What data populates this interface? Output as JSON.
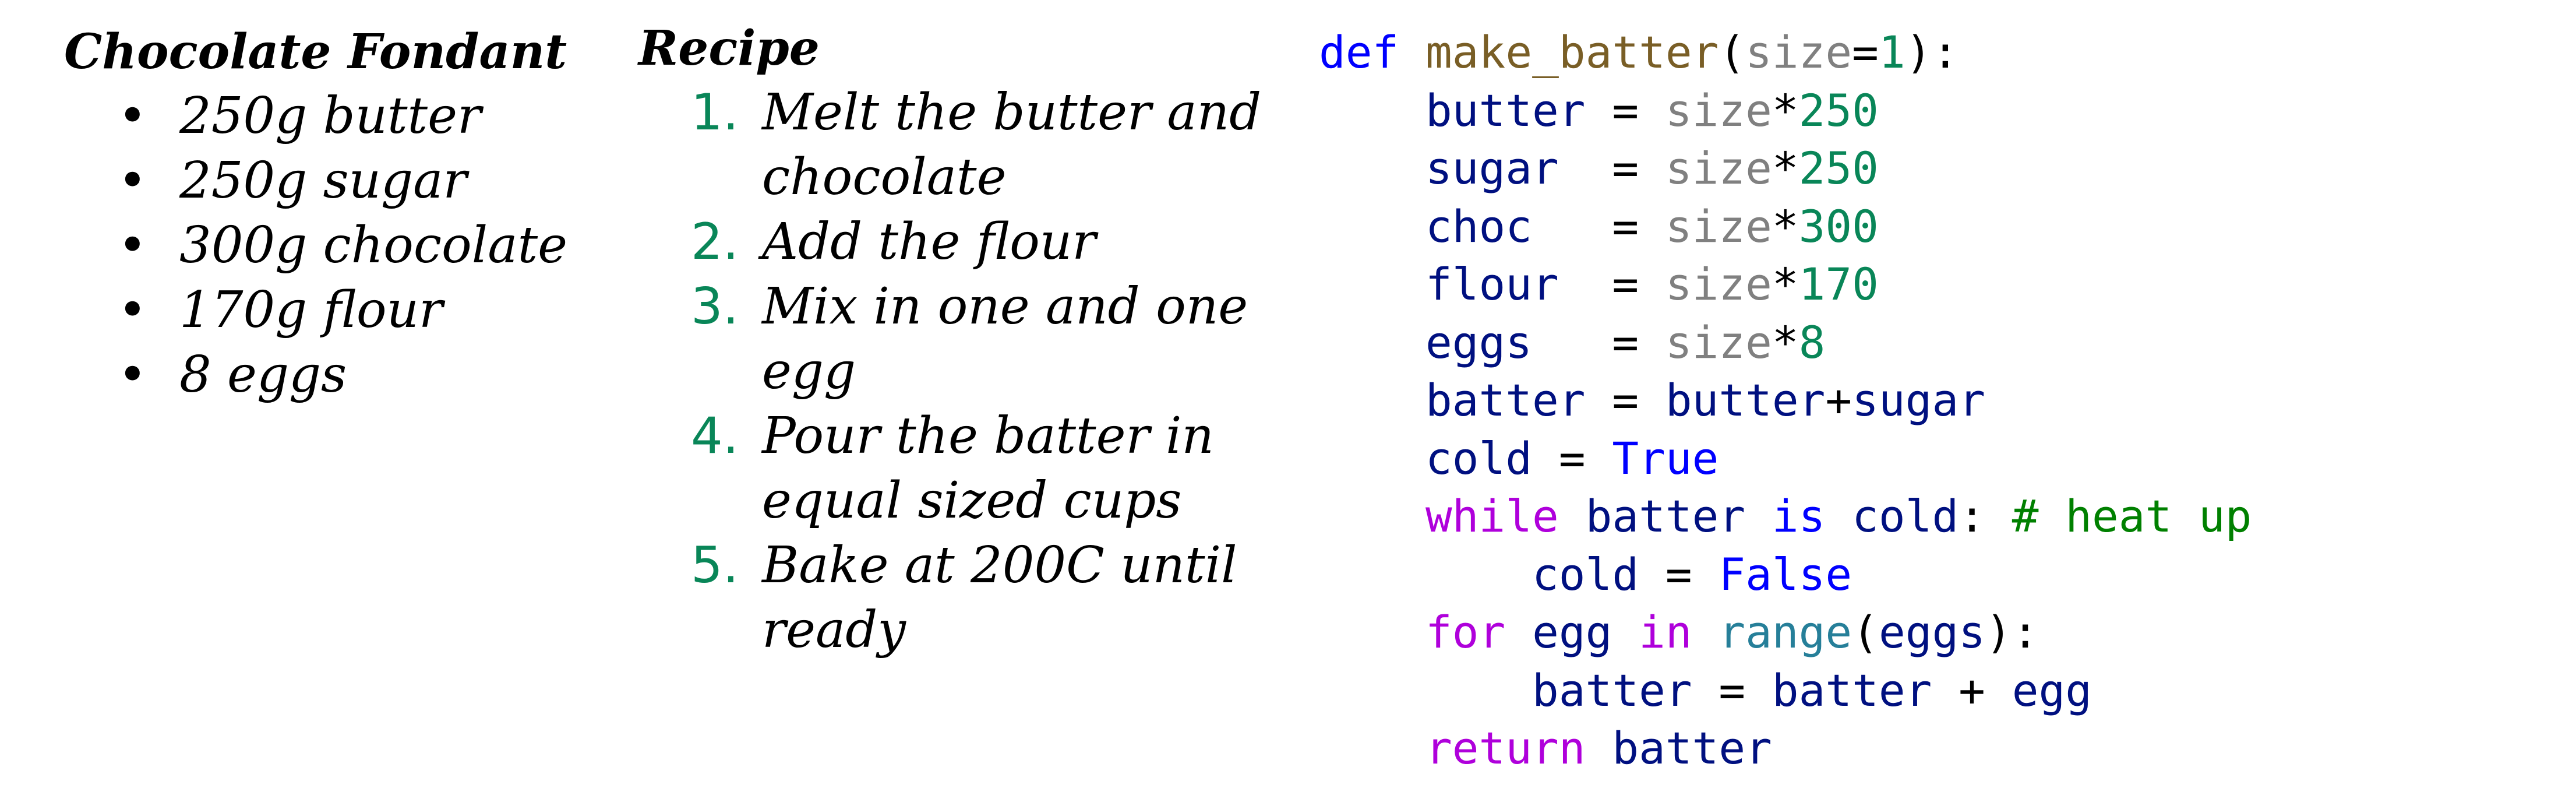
{
  "ingredients": {
    "title": "Chocolate Fondant",
    "items": [
      "250g butter",
      "250g sugar",
      "300g chocolate",
      "170g flour",
      "8 eggs"
    ]
  },
  "recipe": {
    "title": "Recipe",
    "steps": [
      {
        "number": "1.",
        "text": "Melt the butter and chocolate"
      },
      {
        "number": "2.",
        "text": "Add the flour"
      },
      {
        "number": "3.",
        "text": "Mix in one and one egg"
      },
      {
        "number": "4.",
        "text": "Pour the batter in equal sized cups"
      },
      {
        "number": "5.",
        "text": "Bake at 200C until ready"
      }
    ]
  },
  "code": {
    "lines": [
      [
        {
          "t": "def",
          "c": "kw-def"
        },
        {
          "t": " ",
          "c": "op"
        },
        {
          "t": "make_batter",
          "c": "fn"
        },
        {
          "t": "(",
          "c": "op"
        },
        {
          "t": "size",
          "c": "param"
        },
        {
          "t": "=",
          "c": "op"
        },
        {
          "t": "1",
          "c": "num"
        },
        {
          "t": "):",
          "c": "op"
        }
      ],
      [
        {
          "t": "    ",
          "c": "op"
        },
        {
          "t": "butter",
          "c": "var"
        },
        {
          "t": " = ",
          "c": "op"
        },
        {
          "t": "size",
          "c": "param"
        },
        {
          "t": "*",
          "c": "op"
        },
        {
          "t": "250",
          "c": "num"
        }
      ],
      [
        {
          "t": "    ",
          "c": "op"
        },
        {
          "t": "sugar",
          "c": "var"
        },
        {
          "t": "  = ",
          "c": "op"
        },
        {
          "t": "size",
          "c": "param"
        },
        {
          "t": "*",
          "c": "op"
        },
        {
          "t": "250",
          "c": "num"
        }
      ],
      [
        {
          "t": "    ",
          "c": "op"
        },
        {
          "t": "choc",
          "c": "var"
        },
        {
          "t": "   = ",
          "c": "op"
        },
        {
          "t": "size",
          "c": "param"
        },
        {
          "t": "*",
          "c": "op"
        },
        {
          "t": "300",
          "c": "num"
        }
      ],
      [
        {
          "t": "    ",
          "c": "op"
        },
        {
          "t": "flour",
          "c": "var"
        },
        {
          "t": "  = ",
          "c": "op"
        },
        {
          "t": "size",
          "c": "param"
        },
        {
          "t": "*",
          "c": "op"
        },
        {
          "t": "170",
          "c": "num"
        }
      ],
      [
        {
          "t": "    ",
          "c": "op"
        },
        {
          "t": "eggs",
          "c": "var"
        },
        {
          "t": "   = ",
          "c": "op"
        },
        {
          "t": "size",
          "c": "param"
        },
        {
          "t": "*",
          "c": "op"
        },
        {
          "t": "8",
          "c": "num"
        }
      ],
      [
        {
          "t": "    ",
          "c": "op"
        },
        {
          "t": "batter",
          "c": "var"
        },
        {
          "t": " = ",
          "c": "op"
        },
        {
          "t": "butter",
          "c": "var"
        },
        {
          "t": "+",
          "c": "op"
        },
        {
          "t": "sugar",
          "c": "var"
        }
      ],
      [
        {
          "t": "    ",
          "c": "op"
        },
        {
          "t": "cold",
          "c": "var"
        },
        {
          "t": " = ",
          "c": "op"
        },
        {
          "t": "True",
          "c": "const"
        }
      ],
      [
        {
          "t": "    ",
          "c": "op"
        },
        {
          "t": "while",
          "c": "kw-ctrl"
        },
        {
          "t": " ",
          "c": "op"
        },
        {
          "t": "batter",
          "c": "var"
        },
        {
          "t": " ",
          "c": "op"
        },
        {
          "t": "is",
          "c": "kw-def"
        },
        {
          "t": " ",
          "c": "op"
        },
        {
          "t": "cold",
          "c": "var"
        },
        {
          "t": ": ",
          "c": "op"
        },
        {
          "t": "# heat up",
          "c": "comment"
        }
      ],
      [
        {
          "t": "        ",
          "c": "op"
        },
        {
          "t": "cold",
          "c": "var"
        },
        {
          "t": " = ",
          "c": "op"
        },
        {
          "t": "False",
          "c": "const"
        }
      ],
      [
        {
          "t": "    ",
          "c": "op"
        },
        {
          "t": "for",
          "c": "kw-ctrl"
        },
        {
          "t": " ",
          "c": "op"
        },
        {
          "t": "egg",
          "c": "var"
        },
        {
          "t": " ",
          "c": "op"
        },
        {
          "t": "in",
          "c": "kw-ctrl"
        },
        {
          "t": " ",
          "c": "op"
        },
        {
          "t": "range",
          "c": "builtin"
        },
        {
          "t": "(",
          "c": "op"
        },
        {
          "t": "eggs",
          "c": "var"
        },
        {
          "t": "):",
          "c": "op"
        }
      ],
      [
        {
          "t": "        ",
          "c": "op"
        },
        {
          "t": "batter",
          "c": "var"
        },
        {
          "t": " = ",
          "c": "op"
        },
        {
          "t": "batter",
          "c": "var"
        },
        {
          "t": " + ",
          "c": "op"
        },
        {
          "t": "egg",
          "c": "var"
        }
      ],
      [
        {
          "t": "    ",
          "c": "op"
        },
        {
          "t": "return",
          "c": "kw-ctrl"
        },
        {
          "t": " ",
          "c": "op"
        },
        {
          "t": "batter",
          "c": "var"
        }
      ]
    ]
  }
}
